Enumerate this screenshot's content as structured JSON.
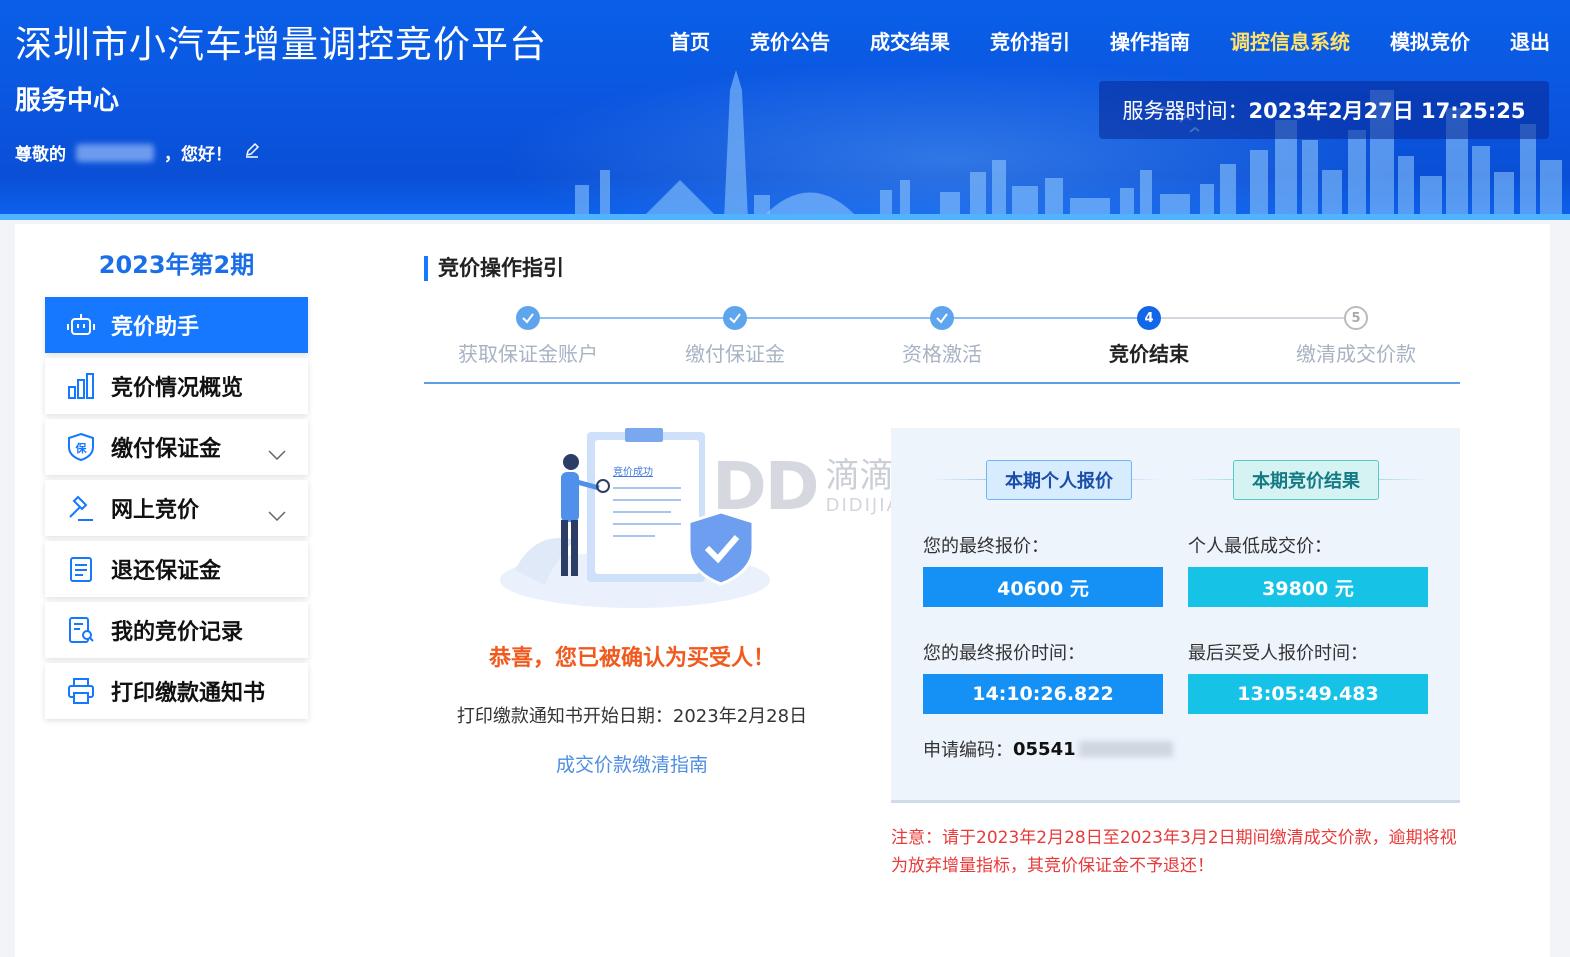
{
  "header": {
    "site_title": "深圳市小汽车增量调控竞价平台",
    "service_center": "服务中心",
    "greeting_prefix": "尊敬的",
    "greeting_suffix": "，您好！",
    "server_time_label": "服务器时间：",
    "server_time_value": "2023年2月27日 17:25:25",
    "nav": [
      {
        "label": "首页",
        "active": false
      },
      {
        "label": "竞价公告",
        "active": false
      },
      {
        "label": "成交结果",
        "active": false
      },
      {
        "label": "竞价指引",
        "active": false
      },
      {
        "label": "操作指南",
        "active": false
      },
      {
        "label": "调控信息系统",
        "active": true
      },
      {
        "label": "模拟竞价",
        "active": false
      },
      {
        "label": "退出",
        "active": false
      }
    ]
  },
  "sidebar": {
    "period": "2023年第2期",
    "items": [
      {
        "label": "竞价助手",
        "icon": "robot-icon",
        "active": true,
        "expandable": false
      },
      {
        "label": "竞价情况概览",
        "icon": "bar-chart-icon",
        "active": false,
        "expandable": false
      },
      {
        "label": "缴付保证金",
        "icon": "shield-bao-icon",
        "active": false,
        "expandable": true
      },
      {
        "label": "网上竞价",
        "icon": "gavel-icon",
        "active": false,
        "expandable": true
      },
      {
        "label": "退还保证金",
        "icon": "refund-doc-icon",
        "active": false,
        "expandable": false
      },
      {
        "label": "我的竞价记录",
        "icon": "record-search-icon",
        "active": false,
        "expandable": false
      },
      {
        "label": "打印缴款通知书",
        "icon": "printer-icon",
        "active": false,
        "expandable": false
      }
    ]
  },
  "main": {
    "section_title": "竞价操作指引",
    "steps": [
      {
        "label": "获取保证金账户",
        "status": "done",
        "marker": ""
      },
      {
        "label": "缴付保证金",
        "status": "done",
        "marker": ""
      },
      {
        "label": "资格激活",
        "status": "done",
        "marker": ""
      },
      {
        "label": "竞价结束",
        "status": "current",
        "marker": "4"
      },
      {
        "label": "缴清成交价款",
        "status": "todo",
        "marker": "5"
      }
    ],
    "illustration_caption": "竞价成功",
    "congrats": "恭喜，您已被确认为买受人！",
    "print_date": "打印缴款通知书开始日期：2023年2月28日",
    "guide_link": "成交价款缴清指南",
    "watermark": {
      "logo": "DD",
      "cn": "滴滴家园",
      "en": "DIDIJIAYUAN"
    }
  },
  "result": {
    "personal_tag": "本期个人报价",
    "result_tag": "本期竞价结果",
    "final_bid_label": "您的最终报价：",
    "final_bid_value": "40600 元",
    "lowest_price_label": "个人最低成交价：",
    "lowest_price_value": "39800 元",
    "final_bid_time_label": "您的最终报价时间：",
    "final_bid_time_value": "14:10:26.822",
    "last_buyer_time_label": "最后买受人报价时间：",
    "last_buyer_time_value": "13:05:49.483",
    "app_code_label": "申请编码：",
    "app_code_value": "05541"
  },
  "notice": "注意：请于2023年2月28日至2023年3月2日期间缴清成交价款，逾期将视为放弃增量指标，其竞价保证金不予退还！",
  "colors": {
    "header_blue": "#0b56e0",
    "accent_blue": "#1677ff",
    "nav_active": "#ffe26a",
    "congrats_orange": "#f05a1e",
    "notice_red": "#e83a3a",
    "value_blue": "#1591f6",
    "value_cyan": "#16c2e6"
  }
}
